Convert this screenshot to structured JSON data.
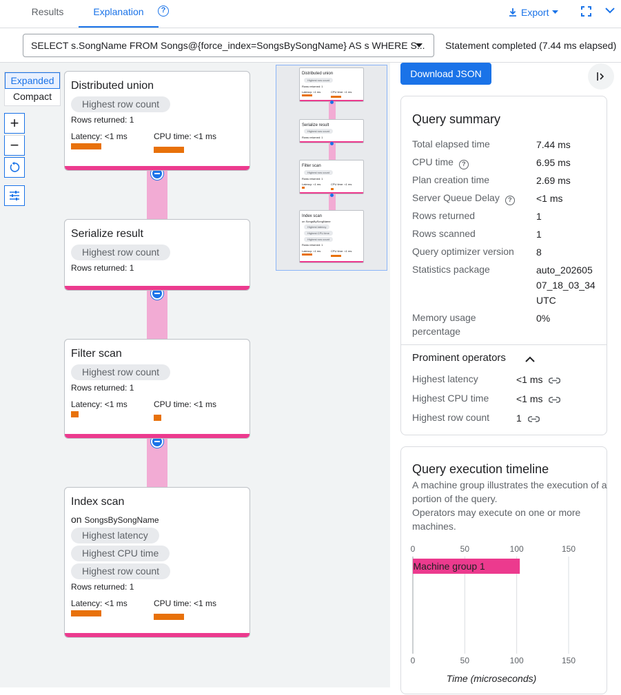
{
  "tabs": {
    "results": "Results",
    "explanation": "Explanation",
    "help": "?",
    "export": "Export"
  },
  "query": {
    "text": "SELECT s.SongName FROM Songs@{force_index=SongsBySongName} AS s WHERE S...",
    "status": "Statement completed (7.44 ms elapsed)"
  },
  "view": {
    "expanded": "Expanded",
    "compact": "Compact",
    "zoom_in": "+",
    "zoom_out": "−"
  },
  "operators": [
    {
      "title": "Distributed union",
      "chips": [
        "Highest row count"
      ],
      "rows_returned": "Rows returned: 1",
      "latency": "Latency: <1 ms",
      "cpu": "CPU time: <1 ms",
      "latency_bar": 1.0,
      "cpu_bar": 1.0
    },
    {
      "title": "Serialize result",
      "chips": [
        "Highest row count"
      ],
      "rows_returned": "Rows returned: 1"
    },
    {
      "title": "Filter scan",
      "chips": [
        "Highest row count"
      ],
      "rows_returned": "Rows returned: 1",
      "latency": "Latency: <1 ms",
      "cpu": "CPU time: <1 ms",
      "latency_bar": 0.25,
      "cpu_bar": 0.25
    },
    {
      "title": "Index scan",
      "on_prefix": "on",
      "on_target": "SongsBySongName",
      "chips": [
        "Highest latency",
        "Highest CPU time",
        "Highest row count"
      ],
      "rows_returned": "Rows returned: 1",
      "latency": "Latency: <1 ms",
      "cpu": "CPU time: <1 ms",
      "latency_bar": 1.0,
      "cpu_bar": 1.0
    }
  ],
  "right_panel": {
    "download": "Download JSON",
    "summary_title": "Query summary",
    "summary": [
      {
        "label": "Total elapsed time",
        "value": "7.44 ms"
      },
      {
        "label": "CPU time",
        "value": "6.95 ms",
        "help": true
      },
      {
        "label": "Plan creation time",
        "value": "2.69 ms"
      },
      {
        "label": "Server Queue Delay",
        "value": "<1 ms",
        "help": true
      },
      {
        "label": "Rows returned",
        "value": "1"
      },
      {
        "label": "Rows scanned",
        "value": "1"
      },
      {
        "label": "Query optimizer version",
        "value": "8"
      },
      {
        "label": "Statistics package",
        "value_lines": [
          "auto_202605",
          "07_18_03_34",
          "UTC"
        ]
      },
      {
        "label_lines": [
          "Memory usage",
          "percentage"
        ],
        "value": "0%"
      }
    ],
    "prominent_title": "Prominent operators",
    "prominent": [
      {
        "label": "Highest latency",
        "value": "<1 ms"
      },
      {
        "label": "Highest CPU time",
        "value": "<1 ms"
      },
      {
        "label": "Highest row count",
        "value": "1"
      }
    ],
    "timeline_title": "Query execution timeline",
    "timeline_desc": [
      "A machine group illustrates the execution of a portion of the query.",
      "Operators may execute on one or more machines."
    ]
  },
  "chart_data": {
    "type": "bar",
    "orientation": "horizontal",
    "categories": [
      "Machine group 1"
    ],
    "series": [
      {
        "name": "Machine group 1",
        "values": [
          [
            0,
            103
          ]
        ]
      }
    ],
    "x_ticks": [
      0,
      50,
      100,
      150
    ],
    "xlim": [
      0,
      150
    ],
    "xlabel": "Time (microseconds)",
    "bar_color": "#ec3a8e"
  },
  "colors": {
    "accent": "#1a73e8",
    "card_bottom": "#ec3a8e",
    "metric_bar": "#e8710a",
    "connector": "#f2abd4"
  }
}
